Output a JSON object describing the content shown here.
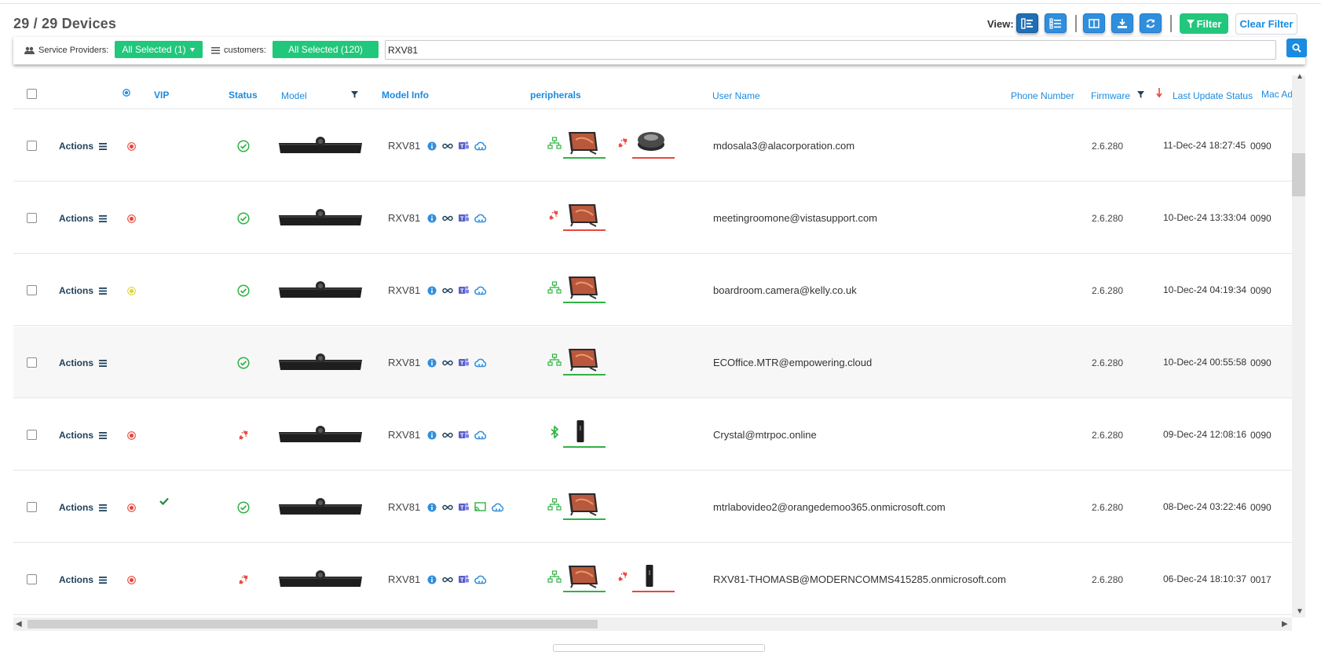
{
  "header": {
    "title": "29 / 29 Devices",
    "view_label": "View:",
    "filter_label": "Filter",
    "clear_filter_label": "Clear Filter",
    "icons": [
      "list-view-icon",
      "detail-view-icon",
      "columns-icon",
      "download-icon",
      "refresh-icon"
    ]
  },
  "filters": {
    "service_providers_label": "Service Providers:",
    "service_providers_value": "All Selected (1)",
    "customers_label": "customers:",
    "customers_value": "All Selected (120)",
    "search_value": "RXV81"
  },
  "columns": {
    "vip": "VIP",
    "status": "Status",
    "model": "Model",
    "model_info": "Model Info",
    "peripherals": "peripherals",
    "user_name": "User Name",
    "phone_number": "Phone Number",
    "firmware": "Firmware",
    "last_update_status": "Last Update Status",
    "mac_address": "Mac Ad"
  },
  "actions_label": "Actions",
  "rows": [
    {
      "online_dot": "red",
      "vip": false,
      "status": "ok",
      "model": "RXV81",
      "model_info_icons": [
        "info-icon",
        "infinity-icon",
        "teams-icon",
        "cloud-icon"
      ],
      "peripherals": [
        {
          "connection": "network",
          "device": "touch-panel",
          "ok": true
        },
        {
          "connection": "disconnected",
          "device": "speakerphone",
          "ok": false
        }
      ],
      "user_name": "mdosala3@alacorporation.com",
      "firmware": "2.6.280",
      "last_update": "11-Dec-24 18:27:45",
      "mac": "0090"
    },
    {
      "online_dot": "red",
      "vip": false,
      "status": "ok",
      "model": "RXV81",
      "model_info_icons": [
        "info-icon",
        "infinity-icon",
        "teams-icon",
        "cloud-icon"
      ],
      "peripherals": [
        {
          "connection": "disconnected",
          "device": "touch-panel",
          "ok": false
        }
      ],
      "user_name": "meetingroomone@vistasupport.com",
      "firmware": "2.6.280",
      "last_update": "10-Dec-24 13:33:04",
      "mac": "0090"
    },
    {
      "online_dot": "yellow",
      "vip": false,
      "status": "ok",
      "model": "RXV81",
      "model_info_icons": [
        "info-icon",
        "infinity-icon",
        "teams-icon",
        "cloud-icon"
      ],
      "peripherals": [
        {
          "connection": "network",
          "device": "touch-panel",
          "ok": true
        }
      ],
      "user_name": "boardroom.camera@kelly.co.uk",
      "firmware": "2.6.280",
      "last_update": "10-Dec-24 04:19:34",
      "mac": "0090"
    },
    {
      "online_dot": "none",
      "vip": false,
      "status": "ok",
      "model": "RXV81",
      "model_info_icons": [
        "info-icon",
        "infinity-icon",
        "teams-icon",
        "cloud-icon"
      ],
      "peripherals": [
        {
          "connection": "network",
          "device": "touch-panel",
          "ok": true
        }
      ],
      "user_name": "ECOffice.MTR@empowering.cloud",
      "firmware": "2.6.280",
      "last_update": "10-Dec-24 00:55:58",
      "mac": "0090"
    },
    {
      "online_dot": "red",
      "vip": false,
      "status": "disconnected",
      "model": "RXV81",
      "model_info_icons": [
        "info-icon",
        "infinity-icon",
        "teams-icon",
        "cloud-icon"
      ],
      "peripherals": [
        {
          "connection": "bluetooth",
          "device": "remote",
          "ok": true
        }
      ],
      "user_name": "Crystal@mtrpoc.online",
      "firmware": "2.6.280",
      "last_update": "09-Dec-24 12:08:16",
      "mac": "0090"
    },
    {
      "online_dot": "red",
      "vip": true,
      "status": "ok",
      "model": "RXV81",
      "model_info_icons": [
        "info-icon",
        "infinity-icon",
        "teams-icon",
        "cast-icon",
        "cloud-icon"
      ],
      "peripherals": [
        {
          "connection": "network",
          "device": "touch-panel",
          "ok": true
        }
      ],
      "user_name": "mtrlabovideo2@orangedemoo365.onmicrosoft.com",
      "firmware": "2.6.280",
      "last_update": "08-Dec-24 03:22:46",
      "mac": "0090"
    },
    {
      "online_dot": "red",
      "vip": false,
      "status": "disconnected",
      "model": "RXV81",
      "model_info_icons": [
        "info-icon",
        "infinity-icon",
        "teams-icon",
        "cloud-icon"
      ],
      "peripherals": [
        {
          "connection": "network",
          "device": "touch-panel",
          "ok": true
        },
        {
          "connection": "disconnected",
          "device": "remote",
          "ok": false
        }
      ],
      "user_name": "RXV81-THOMASB@MODERNCOMMS415285.onmicrosoft.com",
      "firmware": "2.6.280",
      "last_update": "06-Dec-24 18:10:37",
      "mac": "0017"
    }
  ],
  "colors": {
    "accent": "#1a8be0",
    "green": "#21c77b",
    "ok": "#2fb344",
    "error": "#e8473f",
    "warning": "#e2d23a"
  }
}
